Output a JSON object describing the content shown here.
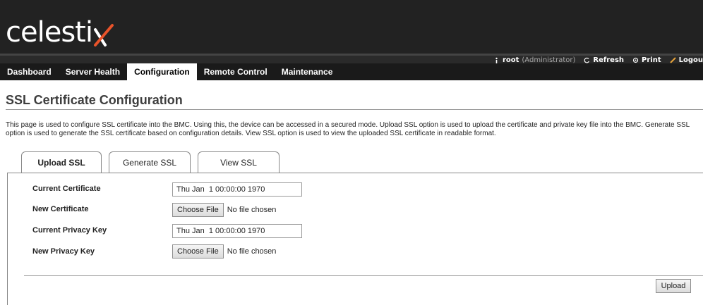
{
  "brand": {
    "logo_text": "celesti",
    "logo_mark": "x",
    "accent_color": "#e8532a"
  },
  "userbar": {
    "user": "root",
    "role": "(Administrator)",
    "refresh_label": "Refresh",
    "print_label": "Print",
    "logout_label": "Logou"
  },
  "nav": {
    "items": [
      {
        "label": "Dashboard"
      },
      {
        "label": "Server Health"
      },
      {
        "label": "Configuration",
        "active": true
      },
      {
        "label": "Remote Control"
      },
      {
        "label": "Maintenance"
      }
    ]
  },
  "page": {
    "title": "SSL Certificate Configuration",
    "description": "This page is used to configure SSL certificate into the BMC. Using this, the device can be accessed in a secured mode. Upload SSL option is used to upload the certificate and private key file into the BMC. Generate SSL option is used to generate the SSL certificate based on configuration details. View SSL option is used to view the uploaded SSL certificate in readable format."
  },
  "tabs": [
    {
      "label": "Upload SSL",
      "active": true
    },
    {
      "label": "Generate SSL"
    },
    {
      "label": "View SSL"
    }
  ],
  "form": {
    "current_certificate_label": "Current Certificate",
    "current_certificate_value": "Thu Jan  1 00:00:00 1970",
    "new_certificate_label": "New Certificate",
    "current_privacy_key_label": "Current Privacy Key",
    "current_privacy_key_value": "Thu Jan  1 00:00:00 1970",
    "new_privacy_key_label": "New Privacy Key",
    "choose_file_label": "Choose File",
    "no_file_text": "No file chosen"
  },
  "actions": {
    "upload_label": "Upload"
  }
}
